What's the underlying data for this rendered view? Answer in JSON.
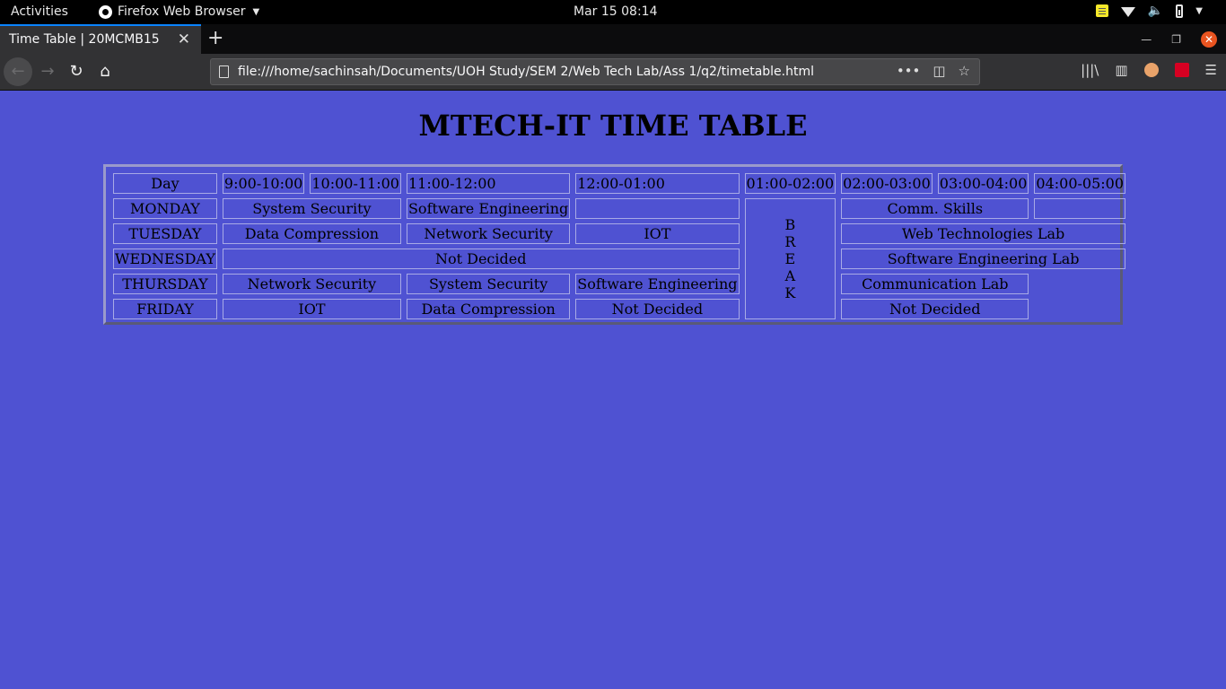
{
  "system_bar": {
    "activities": "Activities",
    "app_name": "Firefox Web Browser",
    "clock": "Mar 15  08:14"
  },
  "browser": {
    "tab_title": "Time Table | 20MCMB15",
    "url": "file:///home/sachinsah/Documents/UOH Study/SEM 2/Web Tech Lab/Ass 1/q2/timetable.html"
  },
  "page": {
    "heading": "MTECH-IT TIME TABLE",
    "table": {
      "header": [
        "Day",
        "9:00-10:00",
        "10:00-11:00",
        "11:00-12:00",
        "12:00-01:00",
        "01:00-02:00",
        "02:00-03:00",
        "03:00-04:00",
        "04:00-05:00"
      ],
      "break_letters": [
        "B",
        "R",
        "E",
        "A",
        "K"
      ],
      "monday": {
        "day": "MONDAY",
        "c1": "System Security",
        "c2": "Software Engineering",
        "c3": "",
        "c4": "Comm. Skills",
        "c5": ""
      },
      "tuesday": {
        "day": "TUESDAY",
        "c1": "Data Compression",
        "c2": "Network Security",
        "c3": "IOT",
        "c4": "Web Technologies Lab"
      },
      "wednesday": {
        "day": "WEDNESDAY",
        "c1": "Not Decided",
        "c2": "Software Engineering Lab"
      },
      "thursday": {
        "day": "THURSDAY",
        "c1": "Network Security",
        "c2": "System Security",
        "c3": "Software Engineering",
        "c4": "Communication Lab"
      },
      "friday": {
        "day": "FRIDAY",
        "c1": "IOT",
        "c2": "Data Compression",
        "c3": "Not Decided",
        "c4": "Not Decided"
      }
    }
  },
  "colors": {
    "page_background": "#4f52d2",
    "text_light": "#d8d8ff",
    "text_red": "#d20a1e",
    "text_dark_red": "#7a0020"
  }
}
